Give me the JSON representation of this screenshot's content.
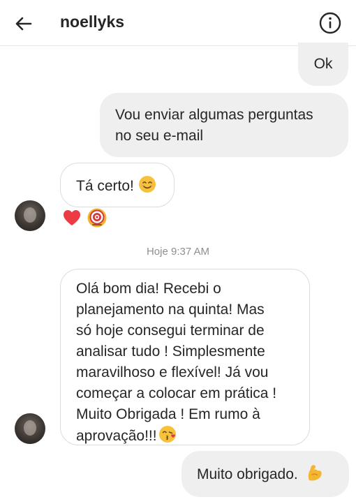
{
  "header": {
    "title": "noellyks",
    "back_icon": "arrow-left-icon",
    "info_icon": "info-circle-icon"
  },
  "messages": [
    {
      "direction": "outgoing",
      "text": "Ok"
    },
    {
      "direction": "outgoing",
      "text_lines": [
        "Vou enviar algumas perguntas",
        "no seu e-mail"
      ]
    },
    {
      "direction": "incoming",
      "text": "Tá certo!",
      "emoji": "smiling-face-icon"
    },
    {
      "direction": "incoming",
      "text_lines": [
        "Olá bom dia! Recebi o",
        "planejamento na quinta! Mas",
        "só hoje consegui terminar de",
        "analisar tudo ! Simplesmente",
        "maravilhoso e flexível! Já vou",
        "começar a colocar em prática !",
        "Muito Obrigada ! Em rumo à",
        "aprovação!!!"
      ],
      "emoji": "kissing-face-icon"
    },
    {
      "direction": "outgoing",
      "text": "Muito obrigado.",
      "emoji": "flexed-biceps-icon"
    }
  ],
  "reactions": [
    "red-heart-icon",
    "bullseye-icon"
  ],
  "timestamp": "Hoje 9:37 AM",
  "colors": {
    "outgoing_bubble": "#efefef",
    "incoming_border": "#dcdcdc",
    "text": "#262626",
    "muted": "#8e8e8e"
  }
}
